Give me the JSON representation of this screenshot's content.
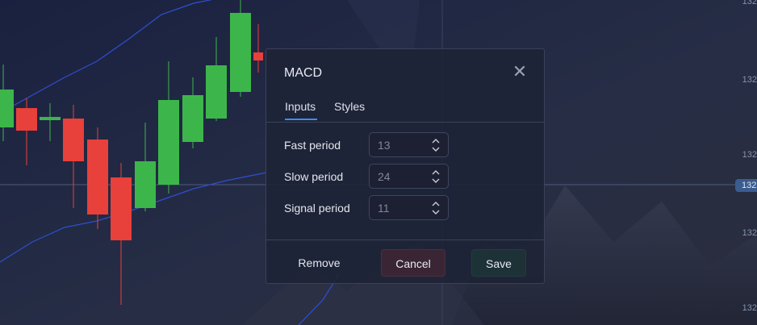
{
  "dialog": {
    "title": "MACD",
    "close_icon": "close-icon",
    "tabs": [
      {
        "label": "Inputs",
        "active": true
      },
      {
        "label": "Styles",
        "active": false
      }
    ],
    "fields": [
      {
        "label": "Fast period",
        "value": "13"
      },
      {
        "label": "Slow period",
        "value": "24"
      },
      {
        "label": "Signal period",
        "value": "11"
      }
    ],
    "buttons": {
      "remove": "Remove",
      "cancel": "Cancel",
      "save": "Save"
    }
  },
  "price_axis": {
    "labels": [
      "132",
      "132",
      "132",
      "132",
      "132",
      "132"
    ],
    "current": "132"
  },
  "colors": {
    "bull": "#3cb64a",
    "bear": "#e8403a",
    "band": "#2f4fcf",
    "accent": "#3d8cf0"
  }
}
